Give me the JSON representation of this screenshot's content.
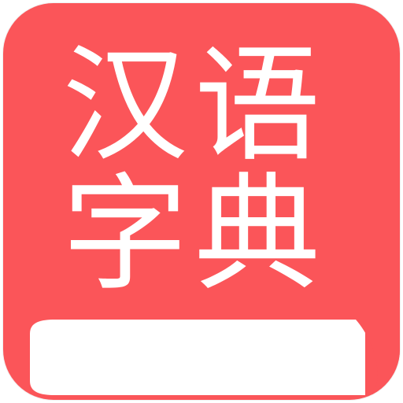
{
  "app": {
    "title_chars": [
      "汉",
      "语",
      "字",
      "典"
    ]
  },
  "colors": {
    "background": "#fb5559",
    "foreground": "#ffffff"
  },
  "icon": {
    "name": "book-icon"
  }
}
